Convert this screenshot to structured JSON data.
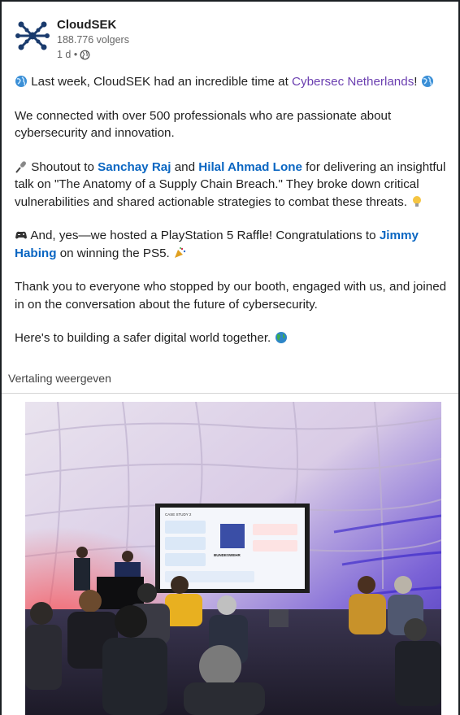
{
  "post": {
    "company_name": "CloudSEK",
    "followers": "188.776 volgers",
    "time": "1 d •",
    "visibility_icon": "globe-icon",
    "p1_a": " Last week, CloudSEK had an incredible time at ",
    "p1_link": "Cybersec Netherlands",
    "p1_b": "! ",
    "p2": "We connected with over 500 professionals who are passionate about cybersecurity and innovation.",
    "p3_a": " Shoutout to ",
    "p3_link1": "Sanchay Raj",
    "p3_and": " and ",
    "p3_link2": "Hilal Ahmad Lone",
    "p3_b": " for delivering an insightful talk on \"The Anatomy of a Supply Chain Breach.\" They broke down critical vulnerabilities and shared actionable strategies to combat these threats. ",
    "p4_a": " And, yes—we hosted a PlayStation 5 Raffle! Congratulations to ",
    "p4_link": "Jimmy Habing",
    "p4_b": " on winning the PS5. ",
    "p5": "Thank you to everyone who stopped by our booth, engaged with us, and joined in on the conversation about the future of cybersecurity.",
    "p6": "Here's to building a safer digital world together. ",
    "translate": "Vertaling weergeven"
  },
  "slide": {
    "case_study": "CASE STUDY 2",
    "brand": "BUNDESWEHR"
  },
  "colors": {
    "link": "#0a66c2",
    "hashtag": "#6b3fb0",
    "logo_blue": "#1a3b6d"
  }
}
